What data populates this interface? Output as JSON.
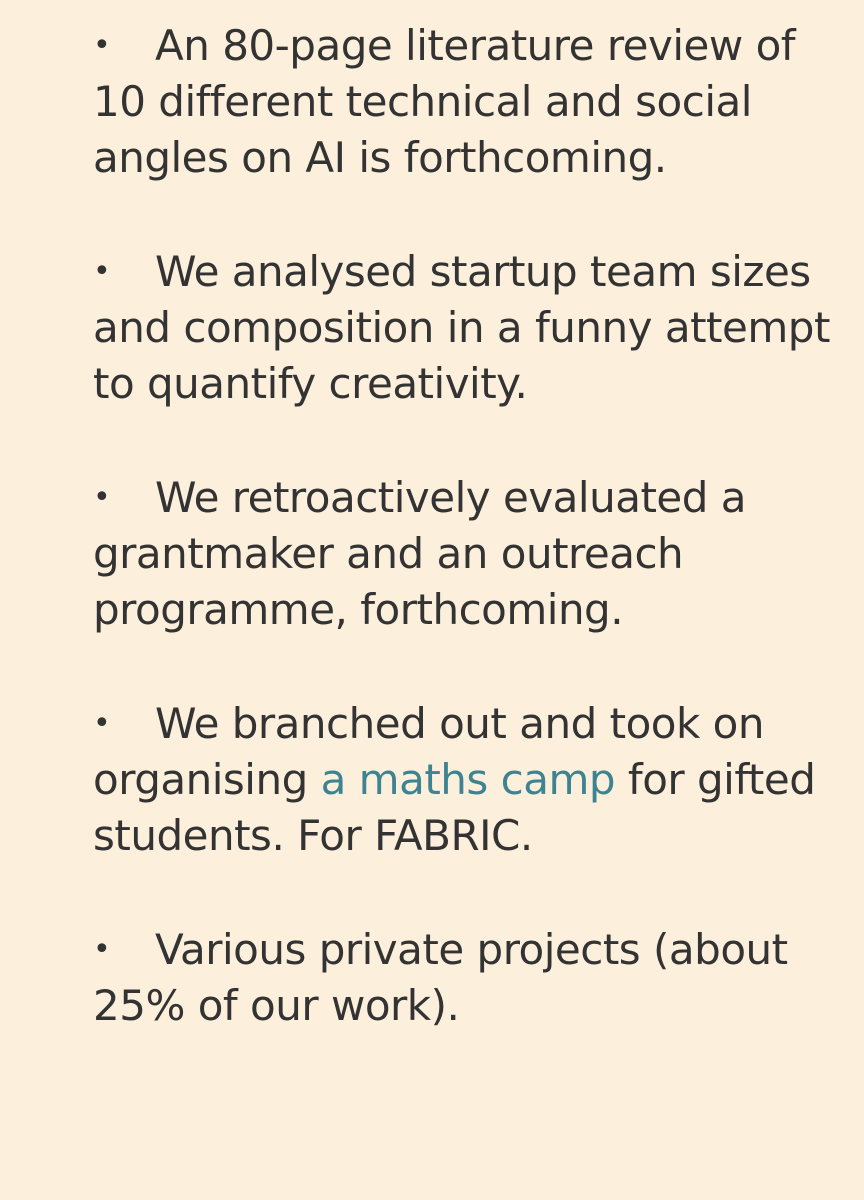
{
  "items": [
    {
      "text": "An 80-page literature review of 10 different technical and social angles on AI is forthcoming."
    },
    {
      "text": "We analysed startup team sizes and composition in a funny attempt to quantify creativity."
    },
    {
      "text": "We retroactively evaluated a grantmaker and an outreach programme, forthcoming."
    },
    {
      "before": "We branched out and took on organising ",
      "link": "a maths camp",
      "after": " for gifted students. For FABRIC."
    },
    {
      "text": "Various private projects (about 25% of our work)."
    }
  ],
  "bullet_symbol": "•",
  "colors": {
    "background": "#fcefdc",
    "text": "#333333",
    "link": "#3e8391"
  }
}
